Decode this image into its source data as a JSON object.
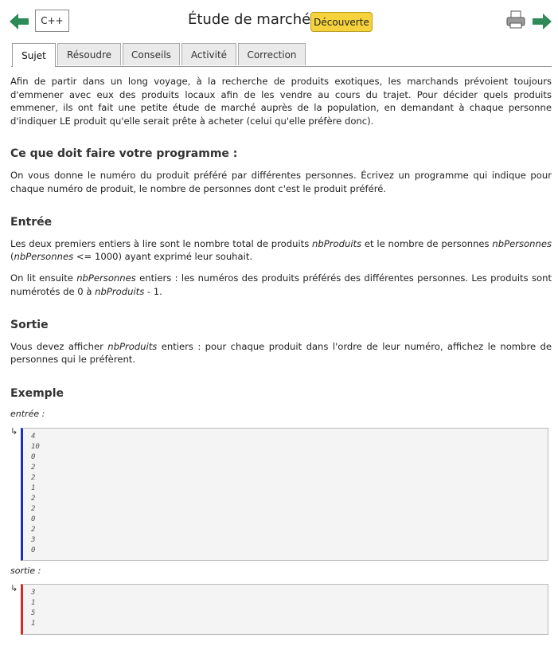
{
  "header": {
    "language": "C++",
    "title": "Étude de marché",
    "badge": "Découverte",
    "icons": [
      "back-arrow-icon",
      "printer-icon",
      "forward-arrow-icon"
    ],
    "colors": {
      "arrow": "#2e8b57",
      "badge": "#f6d33d",
      "input_bar": "#1f2fb8",
      "output_bar": "#d22a2a"
    }
  },
  "tabs": [
    "Sujet",
    "Résoudre",
    "Conseils",
    "Activité",
    "Correction"
  ],
  "active_tab": "Sujet",
  "statement": {
    "intro": "Afin de partir dans un long voyage, à la recherche de produits exotiques, les marchands prévoient toujours d'emmener avec eux des produits locaux afin de les vendre au cours du trajet. Pour décider quels produits emmener, ils ont fait une petite étude de marché auprès de la population, en demandant à chaque personne d'indiquer LE produit qu'elle serait prête à acheter (celui qu'elle préfère donc).",
    "task_heading": "Ce que doit faire votre programme :",
    "task_text": "On vous donne le numéro du produit préféré par différentes personnes. Écrivez un programme qui indique pour chaque numéro de produit, le nombre de personnes dont c'est le produit préféré.",
    "input_heading": "Entrée",
    "input_p1": {
      "t1": "Les deux premiers entiers à lire sont le nombre total de produits ",
      "v1": "nbProduits",
      "t2": " et le nombre de personnes ",
      "v2": "nbPersonnes",
      "t3": " (",
      "v3": "nbPersonnes",
      "t4": " <= 1000) ayant exprimé leur souhait."
    },
    "input_p2": {
      "t1": "On lit ensuite ",
      "v1": "nbPersonnes",
      "t2": " entiers : les numéros des produits préférés des différentes personnes. Les produits sont numérotés de 0 à ",
      "v2": "nbProduits",
      "t3": " - 1."
    },
    "output_heading": "Sortie",
    "output_p": {
      "t1": "Vous devez afficher ",
      "v1": "nbProduits",
      "t2": " entiers : pour chaque produit dans l'ordre de leur numéro, affichez le nombre de personnes qui le préfèrent."
    },
    "example_heading": "Exemple"
  },
  "example": {
    "input_label": "entrée :",
    "output_label": "sortie :",
    "return_glyph": "↳",
    "input_lines": [
      "4",
      "10",
      "0",
      "2",
      "2",
      "1",
      "2",
      "2",
      "0",
      "2",
      "3",
      "0"
    ],
    "output_lines": [
      "3",
      "1",
      "5",
      "1"
    ]
  }
}
